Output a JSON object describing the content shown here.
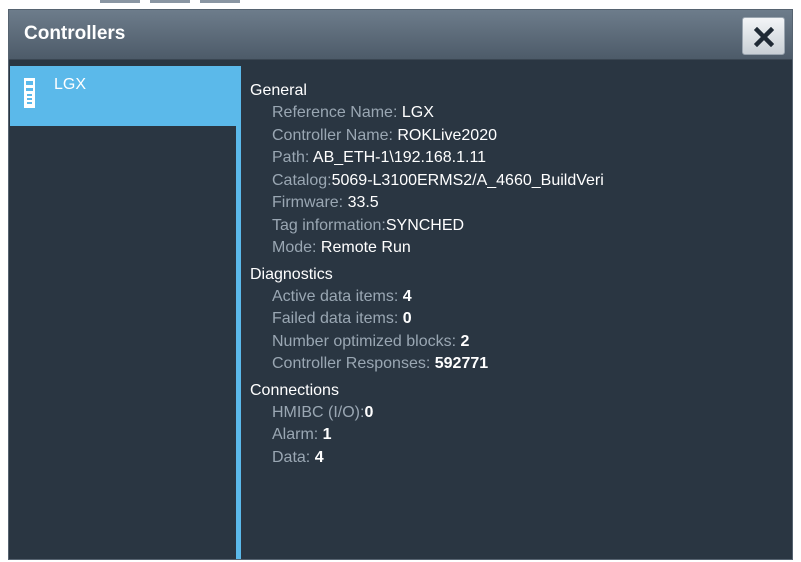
{
  "window": {
    "title": "Controllers",
    "close_icon": "close-icon"
  },
  "sidebar": {
    "items": [
      {
        "label": "LGX",
        "icon": "controller-icon",
        "selected": true
      }
    ]
  },
  "general": {
    "heading": "General",
    "reference_name": {
      "label": "Reference Name: ",
      "value": "LGX"
    },
    "controller_name": {
      "label": "Controller Name: ",
      "value": "ROKLive2020"
    },
    "path": {
      "label": "Path: ",
      "value": "AB_ETH-1\\192.168.1.11"
    },
    "catalog": {
      "label": "Catalog:",
      "value": "5069-L3100ERMS2/A_4660_BuildVeri"
    },
    "firmware": {
      "label": "Firmware: ",
      "value": "33.5"
    },
    "tag_information": {
      "label": "Tag information:",
      "value": "SYNCHED"
    },
    "mode": {
      "label": "Mode: ",
      "value": "Remote Run"
    }
  },
  "diagnostics": {
    "heading": "Diagnostics",
    "active_data_items": {
      "label": "Active data items: ",
      "value": "4"
    },
    "failed_data_items": {
      "label": "Failed data items: ",
      "value": "0"
    },
    "number_optimized_blocks": {
      "label": "Number optimized blocks: ",
      "value": "2"
    },
    "controller_responses": {
      "label": "Controller Responses: ",
      "value": "592771"
    }
  },
  "connections": {
    "heading": "Connections",
    "hmibc": {
      "label": "HMIBC (I/O):",
      "value": "0"
    },
    "alarm": {
      "label": "Alarm: ",
      "value": "1"
    },
    "data": {
      "label": "Data: ",
      "value": "4"
    }
  },
  "colors": {
    "panel": "#2a3642",
    "accent": "#5bb9ea",
    "label_text": "#9aa7b3",
    "value_text": "#ffffff"
  }
}
